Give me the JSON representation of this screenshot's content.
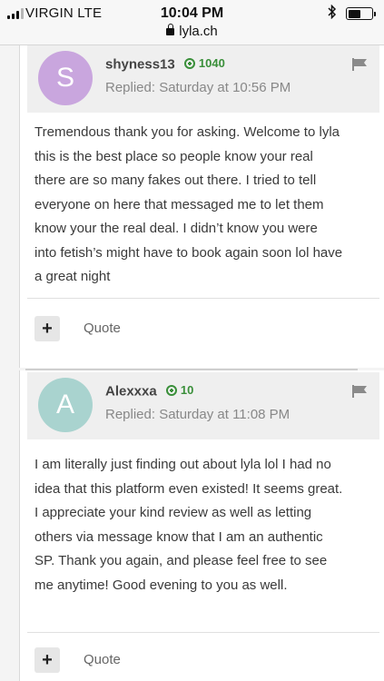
{
  "status_bar": {
    "carrier": "VIRGIN   LTE",
    "time": "10:04 PM",
    "url": "lyla.ch",
    "bluetooth_icon": "bluetooth-icon",
    "battery_level": 0.55
  },
  "posts": [
    {
      "avatar_letter": "S",
      "avatar_color": "#c9a6de",
      "username": "shyness13",
      "points": "1040",
      "replied": "Replied: Saturday at 10:56 PM",
      "body": "Tremendous thank you for asking. Welcome to lyla this is the best place so people know your real there are so many fakes out there. I tried to tell everyone on here that messaged me to let them know your the real deal. I didn’t know you were into fetish’s might have to book again soon lol have a great night",
      "plus_label": "+",
      "quote_label": "Quote"
    },
    {
      "avatar_letter": "A",
      "avatar_color": "#a9d3cf",
      "username": "Alexxxa",
      "points": "10",
      "replied": "Replied: Saturday at 11:08 PM",
      "body": "I am literally just finding out about lyla lol I had no idea that this platform even existed! It seems great. I appreciate your kind review as well as letting others via message know that I am an authentic SP. Thank you again, and please feel free to see me anytime! Good evening to you as well.",
      "plus_label": "+",
      "quote_label": "Quote"
    }
  ],
  "colors": {
    "points_green": "#3a8f3a",
    "header_bg": "#efefef"
  }
}
